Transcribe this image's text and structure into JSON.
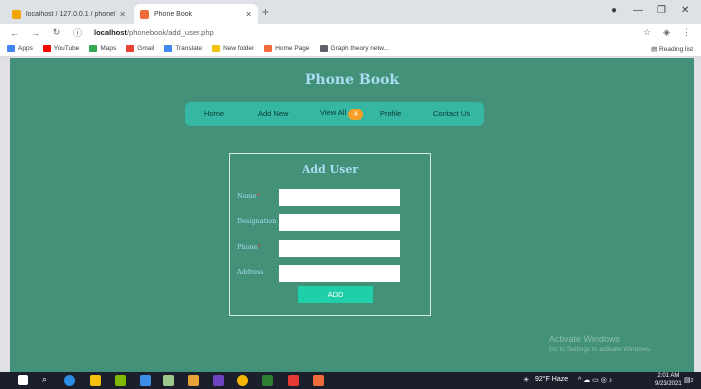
{
  "browser": {
    "tabs": [
      {
        "title": "localhost / 127.0.0.1 / phonebo...",
        "favicon_color": "#f0a500"
      },
      {
        "title": "Phone Book",
        "favicon_color": "#f26b3a"
      }
    ],
    "url_host": "localhost",
    "url_path": "/phonebook/add_user.php",
    "bookmarks": [
      {
        "label": "Apps",
        "color": "#4285f4"
      },
      {
        "label": "YouTube",
        "color": "#ff0000"
      },
      {
        "label": "Maps",
        "color": "#34a853"
      },
      {
        "label": "Gmail",
        "color": "#ea4335"
      },
      {
        "label": "Translate",
        "color": "#4285f4"
      },
      {
        "label": "New folder",
        "color": "#f4c20d"
      },
      {
        "label": "Home Page",
        "color": "#f26b3a"
      },
      {
        "label": "Graph theory netw...",
        "color": "#5f6368"
      }
    ],
    "reading_list": "Reading list"
  },
  "page": {
    "title": "Phone Book",
    "menu": {
      "home": "Home",
      "add_new": "Add New",
      "view_all": "View All",
      "view_all_count": "4",
      "profile": "Profile",
      "contact": "Contact Us"
    },
    "form": {
      "title": "Add User",
      "name_label": "Name",
      "designation_label": "Designation",
      "phone_label": "Phone",
      "address_label": "Address",
      "required_mark": "*",
      "submit": "ADD"
    },
    "watermark": {
      "title": "Activate Windows",
      "subtitle": "Go to Settings to activate Windows."
    }
  },
  "taskbar": {
    "weather": "92°F Haze",
    "time": "2:01 AM",
    "date": "9/23/2021",
    "notification_count": "2"
  },
  "colors": {
    "page_bg": "#44917a",
    "menu_bg": "#35b7a4",
    "heading": "#a8ddf2",
    "badge": "#f7a025",
    "button": "#1fcfa9"
  }
}
